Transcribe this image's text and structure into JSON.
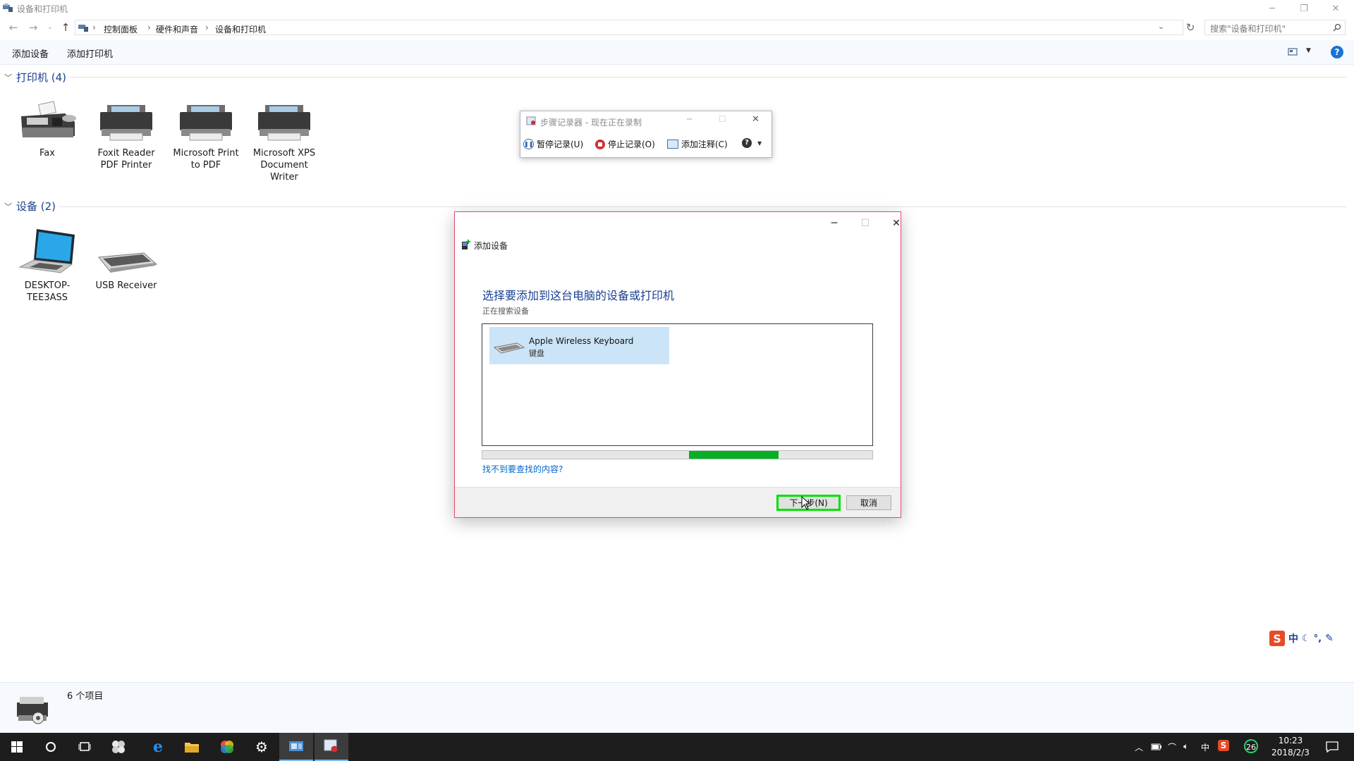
{
  "window": {
    "title": "设备和打印机",
    "controls": {
      "minimize": "─",
      "restore": "❐",
      "close": "✕"
    }
  },
  "address_bar": {
    "breadcrumbs": [
      "控制面板",
      "硬件和声音",
      "设备和打印机"
    ],
    "search_placeholder": "搜索\"设备和打印机\""
  },
  "toolbar": {
    "add_device": "添加设备",
    "add_printer": "添加打印机",
    "help": "?"
  },
  "groups": {
    "printers": {
      "header": "打印机 (4)",
      "items": [
        {
          "label": "Fax",
          "icon": "fax-icon"
        },
        {
          "label": "Foxit Reader PDF Printer",
          "icon": "printer-icon"
        },
        {
          "label": "Microsoft Print to PDF",
          "icon": "printer-icon"
        },
        {
          "label": "Microsoft XPS Document Writer",
          "icon": "printer-icon"
        }
      ]
    },
    "devices": {
      "header": "设备 (2)",
      "items": [
        {
          "label": "DESKTOP-TEE3ASS",
          "icon": "laptop-icon"
        },
        {
          "label": "USB Receiver",
          "icon": "keyboard-icon"
        }
      ]
    }
  },
  "status_bar": {
    "item_count": "6 个项目"
  },
  "steps_recorder": {
    "title": "步骤记录器 - 现在正在录制",
    "pause": "暂停记录(U)",
    "stop": "停止记录(O)",
    "add_comment": "添加注释(C)"
  },
  "add_device_dialog": {
    "title": "添加设备",
    "heading": "选择要添加到这台电脑的设备或打印机",
    "status": "正在搜索设备",
    "device": {
      "name": "Apple Wireless Keyboard",
      "type": "键盘"
    },
    "progress_start_fraction": 0.53,
    "progress_end_fraction": 0.76,
    "help_link": "找不到要查找的内容?",
    "next_button": "下一步(N)",
    "cancel_button": "取消"
  },
  "ime": {
    "mode": "中",
    "icons": [
      "moon-icon",
      "punctuation-icon",
      "wrench-icon"
    ]
  },
  "taskbar": {
    "tray": {
      "lang": "中",
      "badge": "26"
    },
    "time": "10:23",
    "date": "2018/2/3"
  },
  "colors": {
    "accent": "#1b73d1",
    "heading_blue": "#1b3f94",
    "progress_green": "#06b025",
    "highlight_green": "#00e100",
    "dialog_border": "#e24a6b",
    "selection": "#cce4f7"
  }
}
